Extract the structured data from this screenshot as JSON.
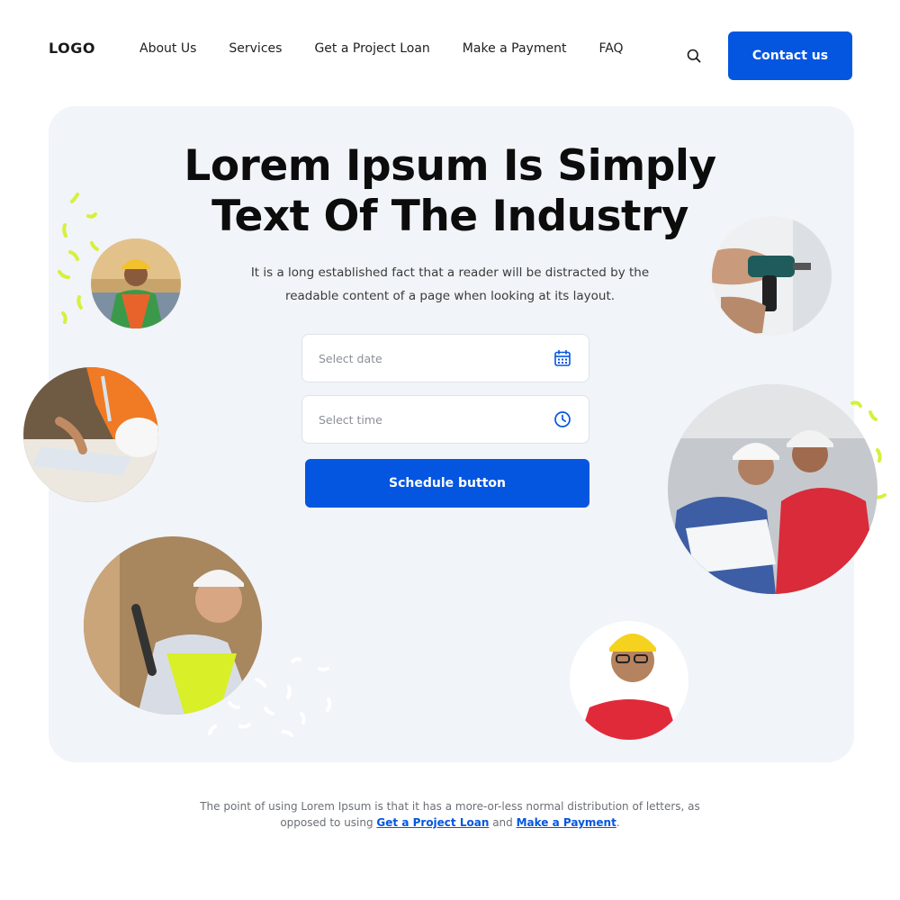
{
  "header": {
    "logo": "LOGO",
    "nav": [
      "About Us",
      "Services",
      "Get a Project Loan",
      "Make a Payment",
      "FAQ"
    ],
    "contact_label": "Contact us",
    "search_icon": "search-icon"
  },
  "hero": {
    "title_line1": "Lorem Ipsum Is Simply",
    "title_line2": "Text Of The Industry",
    "description": "It is a long established fact that a reader will be distracted by the readable content of a page when looking at its layout.",
    "date_placeholder": "Select date",
    "time_placeholder": "Select time",
    "date_icon": "calendar-icon",
    "time_icon": "clock-icon",
    "schedule_label": "Schedule button"
  },
  "footer": {
    "text_before": "The point of using Lorem Ipsum is that it has a more-or-less normal distribution of letters, as opposed to using ",
    "link1": "Get a Project Loan",
    "text_middle": " and ",
    "link2": "Make a Payment",
    "text_after": "."
  },
  "colors": {
    "accent": "#0456e1",
    "hero_bg": "#f1f4f8",
    "confetti_lime": "#d6f03c"
  }
}
